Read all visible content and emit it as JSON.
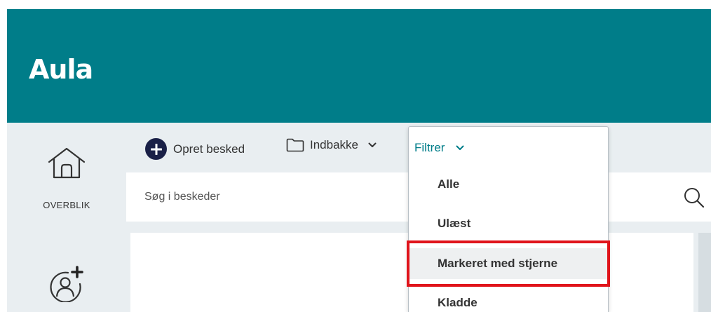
{
  "app": {
    "logo": "Aula"
  },
  "sidebar": {
    "items": [
      {
        "label": "OVERBLIK",
        "icon": "home-icon"
      },
      {
        "label": "",
        "icon": "add-user-icon"
      }
    ]
  },
  "toolbar": {
    "compose_label": "Opret besked",
    "inbox_label": "Indbakke",
    "filter_label": "Filtrer"
  },
  "search": {
    "placeholder": "Søg i beskeder"
  },
  "filter_menu": {
    "options": [
      "Alle",
      "Ulæst",
      "Markeret med stjerne",
      "Kladde"
    ],
    "highlighted": "Markeret med stjerne"
  },
  "colors": {
    "brand": "#007d89",
    "highlight": "#e0141b",
    "compose_icon": "#1a2047"
  }
}
